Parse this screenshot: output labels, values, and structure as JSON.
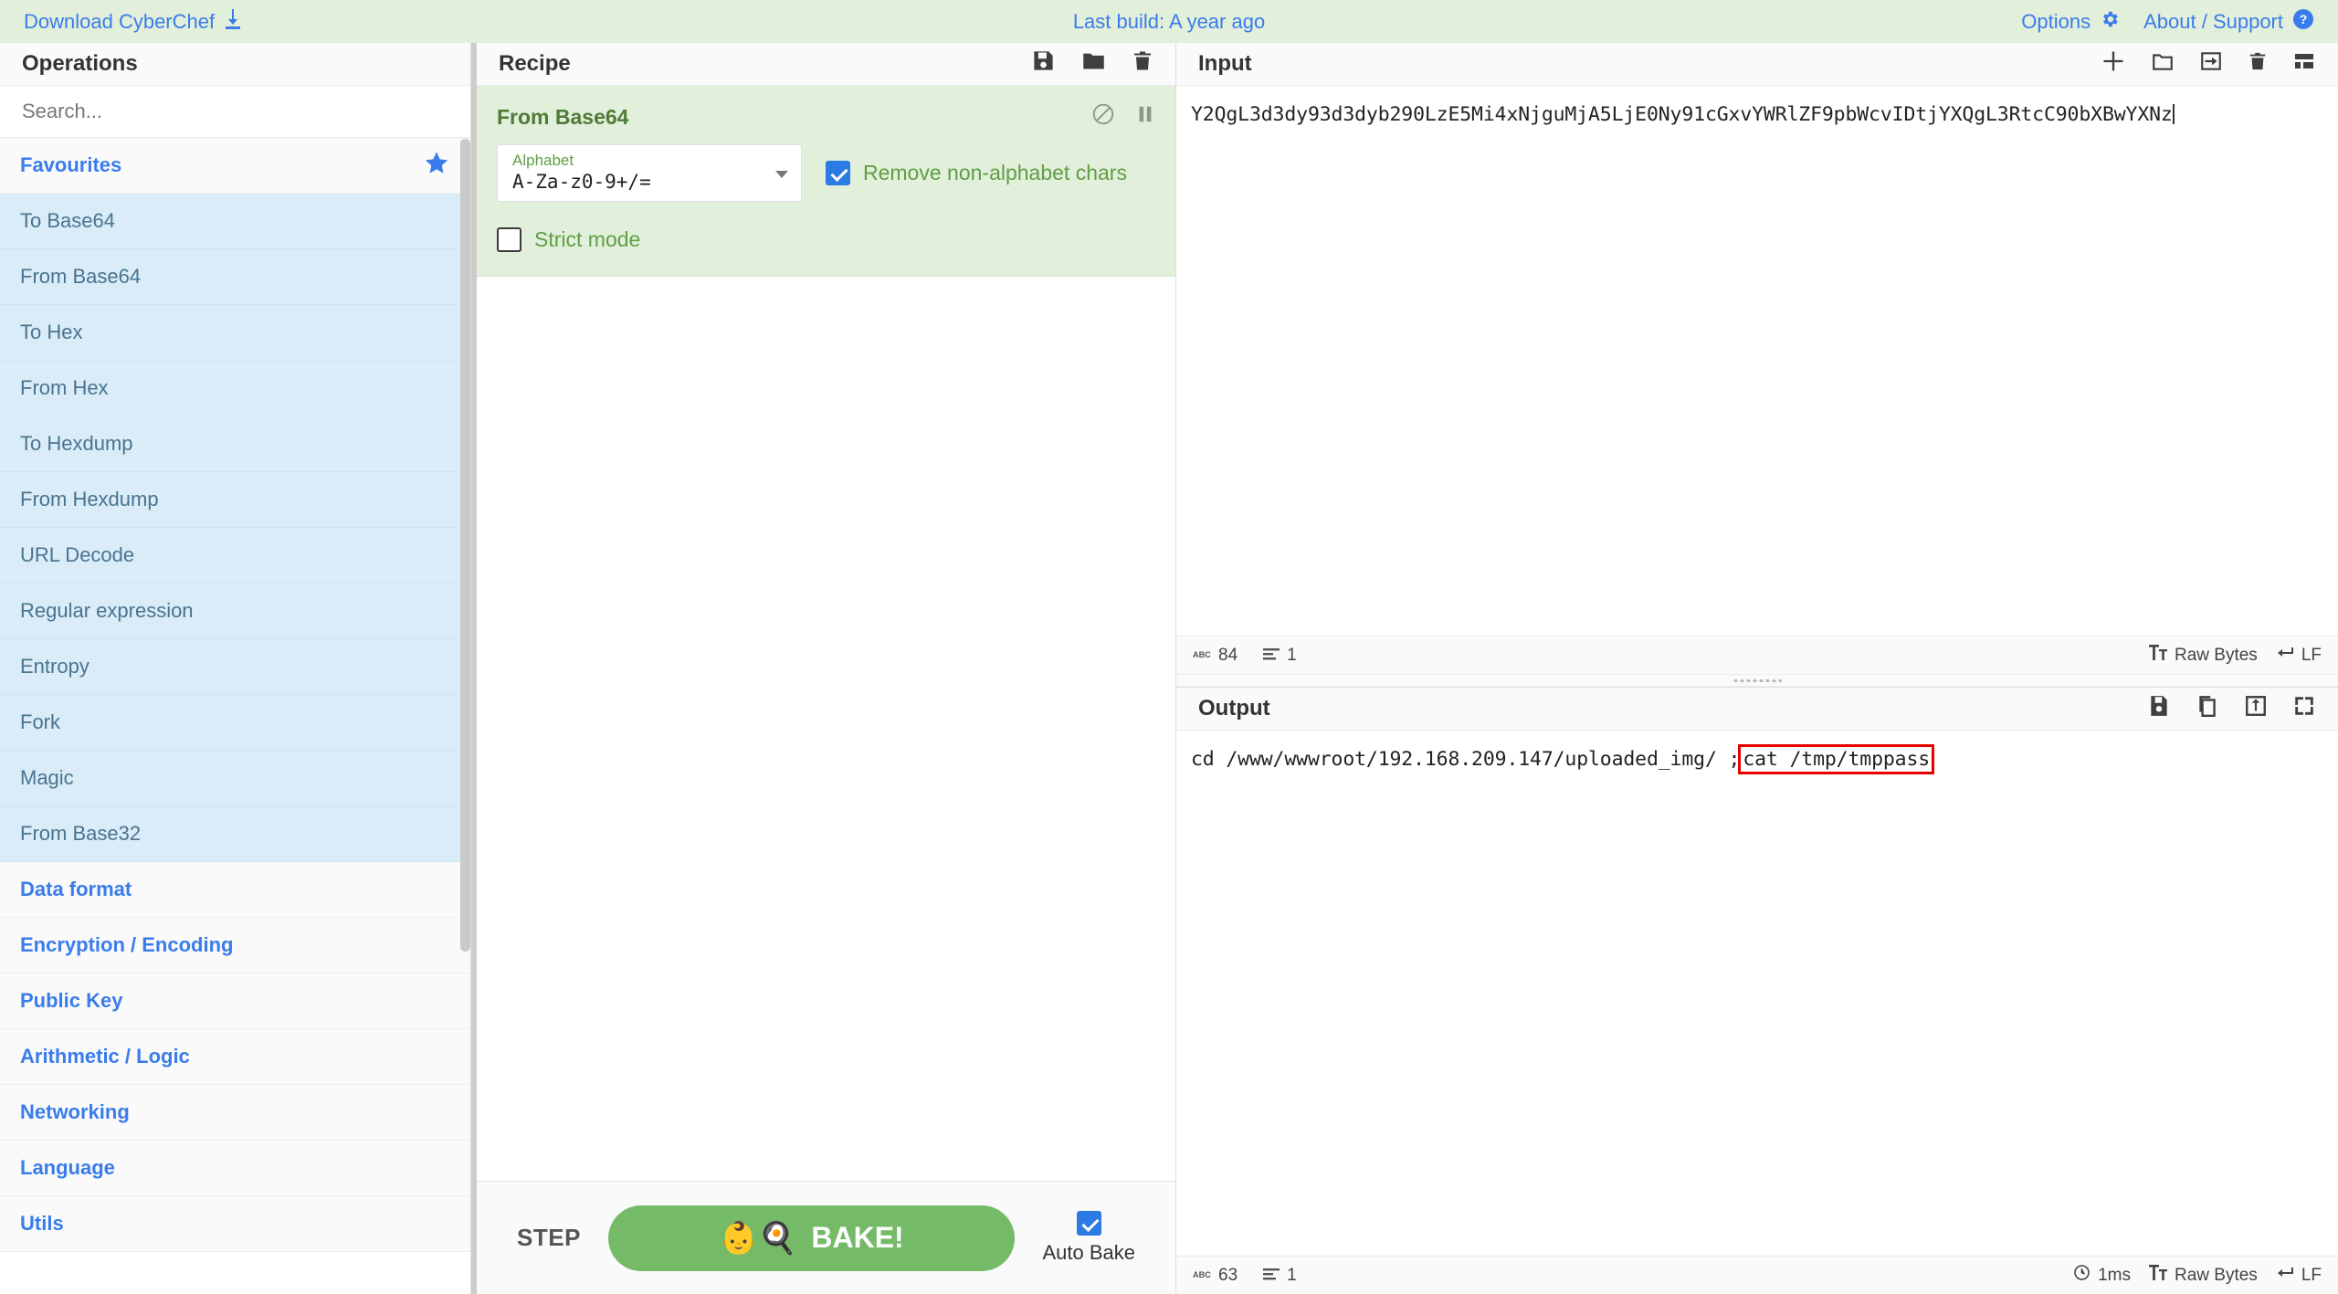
{
  "banner": {
    "download_label": "Download CyberChef",
    "download_icon": "download-icon",
    "last_build": "Last build: A year ago",
    "options_label": "Options",
    "options_icon": "gear-icon",
    "about_label": "About / Support",
    "about_icon": "question-circle-icon",
    "background": "#e2efda",
    "link_color": "#3a7cec"
  },
  "operations": {
    "title": "Operations",
    "search_placeholder": "Search...",
    "search_value": "",
    "favourites": {
      "label": "Favourites",
      "star_icon": "star-icon",
      "items": [
        "To Base64",
        "From Base64",
        "To Hex",
        "From Hex",
        "To Hexdump",
        "From Hexdump",
        "URL Decode",
        "Regular expression",
        "Entropy",
        "Fork",
        "Magic",
        "From Base32"
      ]
    },
    "categories": [
      "Data format",
      "Encryption / Encoding",
      "Public Key",
      "Arithmetic / Logic",
      "Networking",
      "Language",
      "Utils"
    ]
  },
  "recipe": {
    "title": "Recipe",
    "icons": [
      "save-icon",
      "folder-icon",
      "trash-icon"
    ],
    "operation": {
      "name": "From Base64",
      "disable_icon": "disable-icon",
      "pause_icon": "pause-icon",
      "alphabet_label": "Alphabet",
      "alphabet_value": "A-Za-z0-9+/=",
      "remove_nonalphabet_label": "Remove non-alphabet chars",
      "remove_nonalphabet_checked": true,
      "strict_mode_label": "Strict mode",
      "strict_mode_checked": false
    },
    "controls": {
      "step_label": "STEP",
      "bake_label": "BAKE!",
      "bake_icon": "chef-icon",
      "autobake_label": "Auto Bake",
      "autobake_checked": true,
      "bake_color": "#75bb67"
    }
  },
  "input": {
    "title": "Input",
    "icons": [
      "add-tab-icon",
      "open-folder-icon",
      "open-file-icon",
      "trash-icon",
      "layout-icon"
    ],
    "value": "Y2QgL3d3dy93d3dyb290LzE5Mi4xNjguMjA5LjE0Ny91cGxvYWRlZF9pbWcvIDtjYXQgL3RtcC90bXBwYXNz",
    "status": {
      "length_icon": "abc-icon",
      "length": "84",
      "lines_icon": "lines-icon",
      "lines": "1",
      "encoding_icon": "font-icon",
      "encoding": "Raw Bytes",
      "eol_icon": "return-icon",
      "eol": "LF"
    }
  },
  "output": {
    "title": "Output",
    "icons": [
      "save-icon",
      "copy-icon",
      "move-to-input-icon",
      "maximise-icon"
    ],
    "text_before": "cd /www/wwwroot/192.168.209.147/uploaded_img/ ;",
    "text_highlight": "cat /tmp/tmppass",
    "highlight_color": "#e60000",
    "status": {
      "length_icon": "abc-icon",
      "length": "63",
      "lines_icon": "lines-icon",
      "lines": "1",
      "time_icon": "clock-icon",
      "time": "1ms",
      "encoding_icon": "font-icon",
      "encoding": "Raw Bytes",
      "eol_icon": "return-icon",
      "eol": "LF"
    }
  }
}
